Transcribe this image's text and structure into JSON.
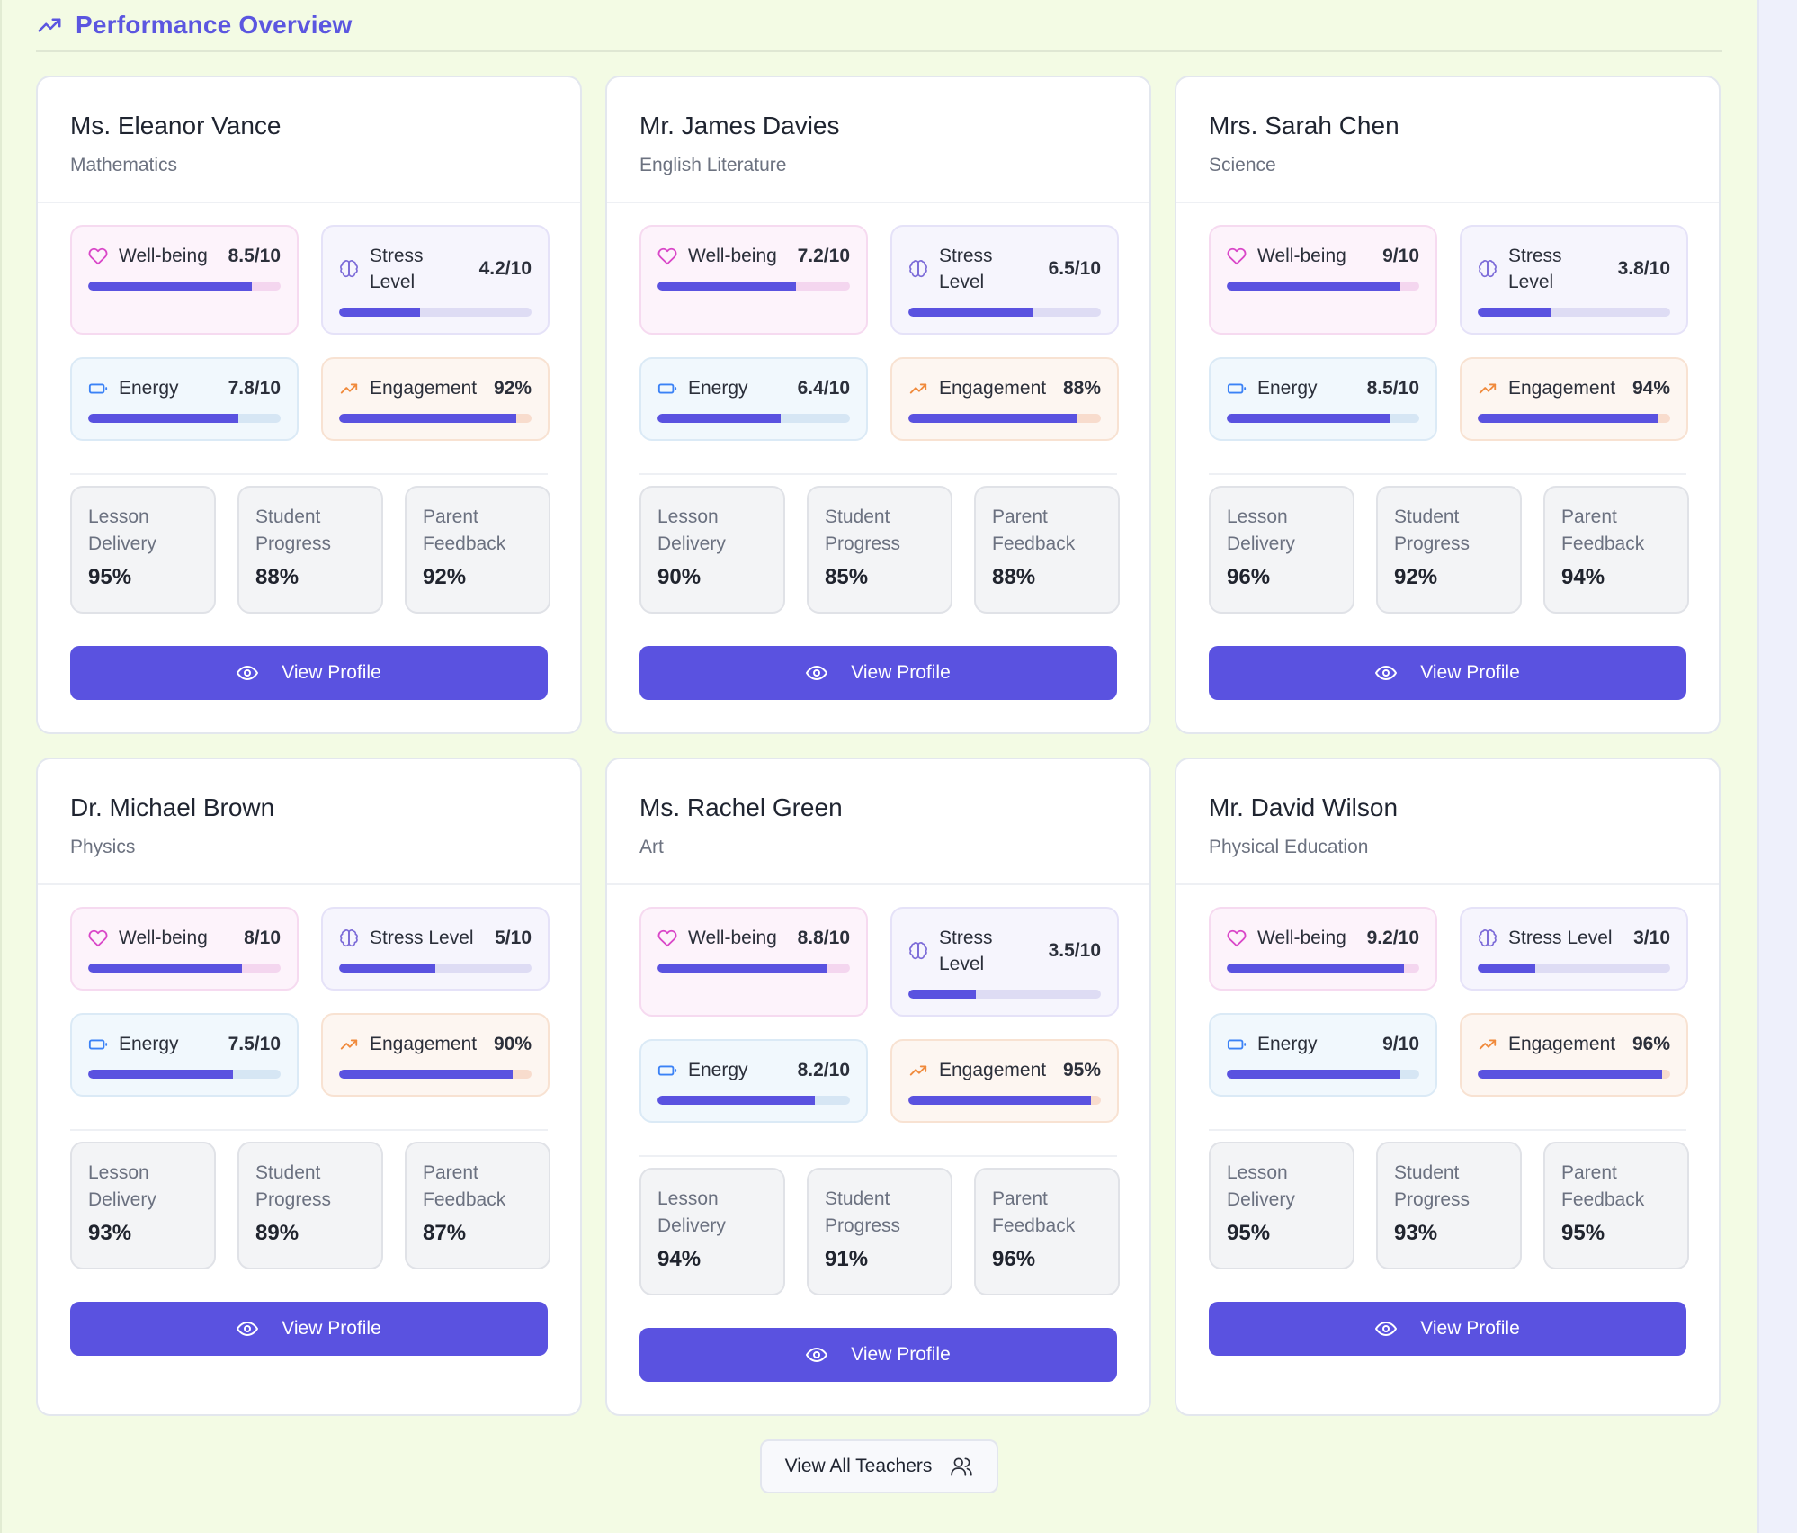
{
  "section": {
    "title": "Performance Overview",
    "icon": "trending-up-icon"
  },
  "teachers": [
    {
      "name": "Ms. Eleanor Vance",
      "subject": "Mathematics",
      "wellbeing": {
        "label": "Well-being",
        "value": "8.5/10",
        "pct": 0.85
      },
      "stress": {
        "label": "Stress Level",
        "value": "4.2/10",
        "pct": 0.42
      },
      "energy": {
        "label": "Energy",
        "value": "7.8/10",
        "pct": 0.78
      },
      "engagement": {
        "label": "Engagement",
        "value": "92%",
        "pct": 0.92
      },
      "stats": [
        {
          "label": "Lesson Delivery",
          "value": "95%"
        },
        {
          "label": "Student Progress",
          "value": "88%"
        },
        {
          "label": "Parent Feedback",
          "value": "92%"
        }
      ],
      "button": "View Profile"
    },
    {
      "name": "Mr. James Davies",
      "subject": "English Literature",
      "wellbeing": {
        "label": "Well-being",
        "value": "7.2/10",
        "pct": 0.72
      },
      "stress": {
        "label": "Stress Level",
        "value": "6.5/10",
        "pct": 0.65
      },
      "energy": {
        "label": "Energy",
        "value": "6.4/10",
        "pct": 0.64
      },
      "engagement": {
        "label": "Engagement",
        "value": "88%",
        "pct": 0.88
      },
      "stats": [
        {
          "label": "Lesson Delivery",
          "value": "90%"
        },
        {
          "label": "Student Progress",
          "value": "85%"
        },
        {
          "label": "Parent Feedback",
          "value": "88%"
        }
      ],
      "button": "View Profile"
    },
    {
      "name": "Mrs. Sarah Chen",
      "subject": "Science",
      "wellbeing": {
        "label": "Well-being",
        "value": "9/10",
        "pct": 0.9
      },
      "stress": {
        "label": "Stress Level",
        "value": "3.8/10",
        "pct": 0.38
      },
      "energy": {
        "label": "Energy",
        "value": "8.5/10",
        "pct": 0.85
      },
      "engagement": {
        "label": "Engagement",
        "value": "94%",
        "pct": 0.94
      },
      "stats": [
        {
          "label": "Lesson Delivery",
          "value": "96%"
        },
        {
          "label": "Student Progress",
          "value": "92%"
        },
        {
          "label": "Parent Feedback",
          "value": "94%"
        }
      ],
      "button": "View Profile"
    },
    {
      "name": "Dr. Michael Brown",
      "subject": "Physics",
      "wellbeing": {
        "label": "Well-being",
        "value": "8/10",
        "pct": 0.8
      },
      "stress": {
        "label": "Stress Level",
        "value": "5/10",
        "pct": 0.5
      },
      "energy": {
        "label": "Energy",
        "value": "7.5/10",
        "pct": 0.75
      },
      "engagement": {
        "label": "Engagement",
        "value": "90%",
        "pct": 0.9
      },
      "stats": [
        {
          "label": "Lesson Delivery",
          "value": "93%"
        },
        {
          "label": "Student Progress",
          "value": "89%"
        },
        {
          "label": "Parent Feedback",
          "value": "87%"
        }
      ],
      "button": "View Profile"
    },
    {
      "name": "Ms. Rachel Green",
      "subject": "Art",
      "wellbeing": {
        "label": "Well-being",
        "value": "8.8/10",
        "pct": 0.88
      },
      "stress": {
        "label": "Stress Level",
        "value": "3.5/10",
        "pct": 0.35
      },
      "energy": {
        "label": "Energy",
        "value": "8.2/10",
        "pct": 0.82
      },
      "engagement": {
        "label": "Engagement",
        "value": "95%",
        "pct": 0.95
      },
      "stats": [
        {
          "label": "Lesson Delivery",
          "value": "94%"
        },
        {
          "label": "Student Progress",
          "value": "91%"
        },
        {
          "label": "Parent Feedback",
          "value": "96%"
        }
      ],
      "button": "View Profile"
    },
    {
      "name": "Mr. David Wilson",
      "subject": "Physical Education",
      "wellbeing": {
        "label": "Well-being",
        "value": "9.2/10",
        "pct": 0.92
      },
      "stress": {
        "label": "Stress Level",
        "value": "3/10",
        "pct": 0.3
      },
      "energy": {
        "label": "Energy",
        "value": "9/10",
        "pct": 0.9
      },
      "engagement": {
        "label": "Engagement",
        "value": "96%",
        "pct": 0.96
      },
      "stats": [
        {
          "label": "Lesson Delivery",
          "value": "95%"
        },
        {
          "label": "Student Progress",
          "value": "93%"
        },
        {
          "label": "Parent Feedback",
          "value": "95%"
        }
      ],
      "button": "View Profile"
    }
  ],
  "footer": {
    "view_all_label": "View All Teachers",
    "icon": "users-icon"
  },
  "colors": {
    "accent": "#5a52e0",
    "heart": "#d946c8",
    "brain": "#7c6bd8",
    "battery": "#3b82f6",
    "trend": "#f08a3c"
  }
}
